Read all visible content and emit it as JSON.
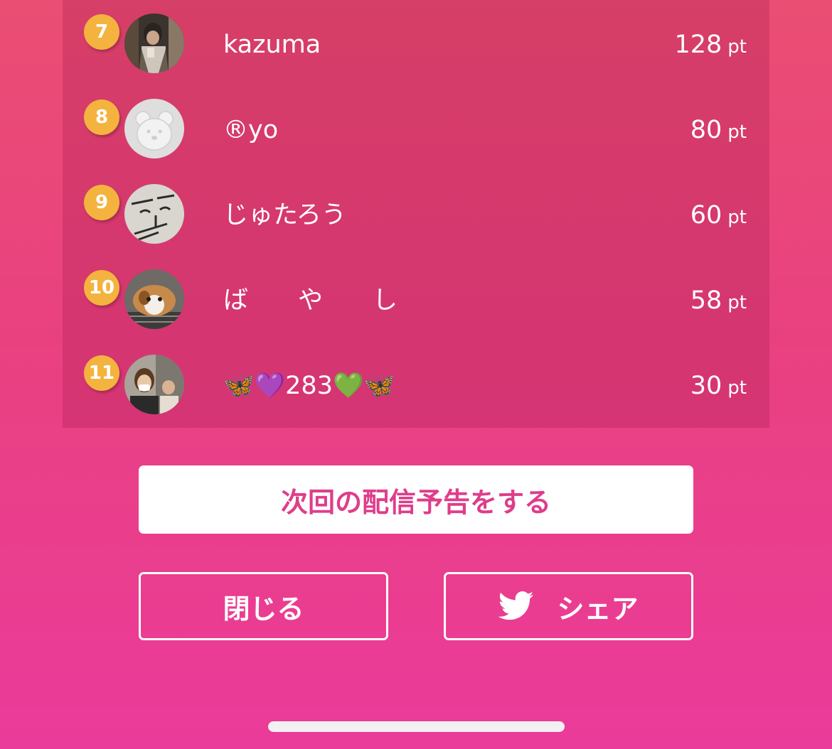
{
  "ranking": [
    {
      "rank": "7",
      "name": "kazuma",
      "points": "128",
      "unit": "pt",
      "avatar": "man-mirror-selfie"
    },
    {
      "rank": "8",
      "name": "®yo",
      "points": "80",
      "unit": "pt",
      "avatar": "default-bear"
    },
    {
      "rank": "9",
      "name": "じゅたろう",
      "points": "60",
      "unit": "pt",
      "avatar": "doodle-face"
    },
    {
      "rank": "10",
      "name": "ば　　や　　し",
      "points": "58",
      "unit": "pt",
      "avatar": "guinea-pig"
    },
    {
      "rank": "11",
      "name": "🦋💜283💚🦋",
      "points": "30",
      "unit": "pt",
      "avatar": "two-people-selfie"
    }
  ],
  "actions": {
    "schedule_label": "次回の配信予告をする",
    "close_label": "閉じる",
    "share_label": "シェア",
    "share_icon": "twitter-bird-icon"
  },
  "colors": {
    "accent_text": "#df3d8b",
    "rank_badge": "#f4b33e"
  }
}
